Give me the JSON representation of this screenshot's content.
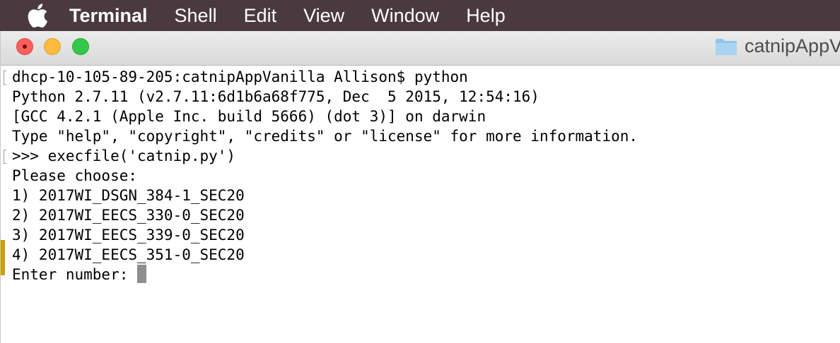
{
  "menubar": {
    "apple_icon": "apple-logo-icon",
    "app_name": "Terminal",
    "items": [
      "Shell",
      "Edit",
      "View",
      "Window",
      "Help"
    ]
  },
  "window": {
    "title": "catnipAppV",
    "folder_icon": "folder-icon",
    "buttons": {
      "close": "#fc605c",
      "minimize": "#fdbc40",
      "maximize": "#34c84a"
    }
  },
  "terminal": {
    "lines": [
      "dhcp-10-105-89-205:catnipAppVanilla Allison$ python",
      "Python 2.7.11 (v2.7.11:6d1b6a68f775, Dec  5 2015, 12:54:16)",
      "[GCC 4.2.1 (Apple Inc. build 5666) (dot 3)] on darwin",
      "Type \"help\", \"copyright\", \"credits\" or \"license\" for more information.",
      ">>> execfile('catnip.py')",
      "Please choose:",
      "1) 2017WI_DSGN_384-1_SEC20",
      "2) 2017WI_EECS_330-0_SEC20",
      "3) 2017WI_EECS_339-0_SEC20",
      "4) 2017WI_EECS_351-0_SEC20",
      "Enter number: "
    ],
    "cursor_color": "#8e8e8e"
  }
}
